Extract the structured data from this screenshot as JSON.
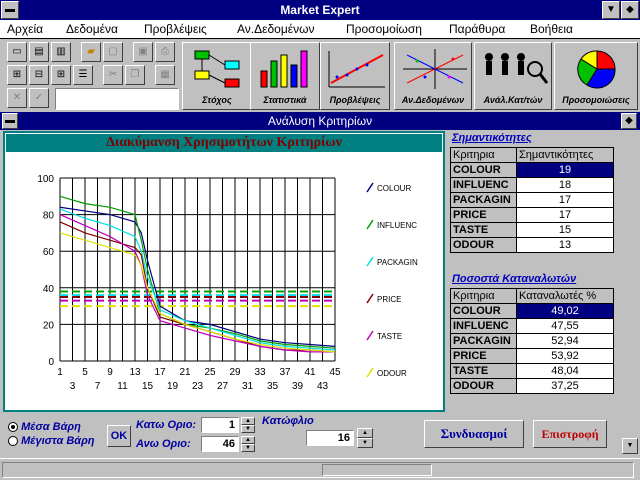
{
  "window": {
    "title": "Market Expert"
  },
  "menu": [
    {
      "label": "Αρχεία"
    },
    {
      "label": "Δεδομένα"
    },
    {
      "label": "Προβλέψεις"
    },
    {
      "label": "Αν.Δεδομένων"
    },
    {
      "label": "Προσομοίωση"
    },
    {
      "label": "Παράθυρα"
    },
    {
      "label": "Βοήθεια"
    }
  ],
  "modules": [
    {
      "label": "Στόχος",
      "icon": "target-flowchart-icon"
    },
    {
      "label": "Στατιστικά",
      "icon": "bar-chart-icon"
    },
    {
      "label": "Προβλέψεις",
      "icon": "trend-line-icon"
    },
    {
      "label": "Αν.Δεδομένων",
      "icon": "scatter-analysis-icon"
    },
    {
      "label": "Ανάλ.Κατ/τών",
      "icon": "people-analysis-icon"
    },
    {
      "label": "Προσομοιώσεις",
      "icon": "pie-chart-icon"
    }
  ],
  "panel": {
    "title": "Ανάλυση Κριτηρίων"
  },
  "chart_data": {
    "type": "line",
    "title": "Διακύμανση Χρησιμοτήτων Κριτηρίων",
    "ylim": [
      0,
      100
    ],
    "yticks": [
      0,
      20,
      40,
      60,
      80,
      100
    ],
    "xlim": [
      1,
      45
    ],
    "xticks_top": [
      "1",
      "5",
      "9",
      "13",
      "17",
      "21",
      "25",
      "29",
      "33",
      "37",
      "41",
      "45"
    ],
    "xticks_bottom": [
      "3",
      "7",
      "11",
      "15",
      "19",
      "23",
      "27",
      "31",
      "35",
      "39",
      "43"
    ],
    "grid": true,
    "legend_position": "right",
    "x": [
      1,
      5,
      9,
      13,
      14,
      15,
      17,
      21,
      25,
      29,
      33,
      37,
      41,
      45
    ],
    "series": [
      {
        "name": "COLOUR",
        "color": "#000080",
        "values": [
          84,
          82,
          80,
          76,
          70,
          55,
          30,
          22,
          20,
          16,
          12,
          10,
          9,
          8
        ]
      },
      {
        "name": "INFLUENC",
        "color": "#00a000",
        "values": [
          90,
          86,
          84,
          80,
          66,
          50,
          26,
          20,
          18,
          15,
          11,
          9,
          8,
          7
        ]
      },
      {
        "name": "PACKAGIN",
        "color": "#00e0e0",
        "values": [
          83,
          78,
          74,
          68,
          60,
          46,
          28,
          22,
          18,
          14,
          10,
          8,
          7,
          6
        ]
      },
      {
        "name": "PRICE",
        "color": "#800000",
        "values": [
          76,
          70,
          66,
          62,
          58,
          40,
          24,
          20,
          16,
          12,
          8,
          6,
          6,
          5
        ]
      },
      {
        "name": "TASTE",
        "color": "#c000c0",
        "values": [
          80,
          74,
          68,
          60,
          52,
          36,
          22,
          18,
          14,
          11,
          8,
          6,
          5,
          5
        ]
      },
      {
        "name": "ODOUR",
        "color": "#e0e000",
        "values": [
          70,
          66,
          62,
          58,
          52,
          40,
          26,
          20,
          16,
          12,
          9,
          7,
          6,
          5
        ]
      }
    ],
    "thresholds": [
      {
        "color": "#00a000",
        "value": 38
      },
      {
        "color": "#00e0e0",
        "value": 36
      },
      {
        "color": "#800000",
        "value": 35
      },
      {
        "color": "#c000c0",
        "value": 33
      },
      {
        "color": "#e0e000",
        "value": 30
      }
    ]
  },
  "importance": {
    "title": "Σημαντικότητες",
    "header": [
      "Κριτηρια",
      "Σημαντικότητες"
    ],
    "rows": [
      {
        "name": "COLOUR",
        "value": "19"
      },
      {
        "name": "INFLUENC",
        "value": "18"
      },
      {
        "name": "PACKAGIN",
        "value": "17"
      },
      {
        "name": "PRICE",
        "value": "17"
      },
      {
        "name": "TASTE",
        "value": "15"
      },
      {
        "name": "ODOUR",
        "value": "13"
      }
    ]
  },
  "consumers": {
    "title": "Ποσοστά Καταναλωτών",
    "header": [
      "Κριτηρια",
      "Καταναλωτές %"
    ],
    "rows": [
      {
        "name": "COLOUR",
        "value": "49,02"
      },
      {
        "name": "INFLUENC",
        "value": "47,55"
      },
      {
        "name": "PACKAGIN",
        "value": "52,94"
      },
      {
        "name": "PRICE",
        "value": "53,92"
      },
      {
        "name": "TASTE",
        "value": "48,04"
      },
      {
        "name": "ODOUR",
        "value": "37,25"
      }
    ]
  },
  "controls": {
    "radio_mean": "Μέσα Βάρη",
    "radio_max": "Μέγιστα Βάρη",
    "ok": "OK",
    "lower_label": "Κατω Οριο:",
    "lower_value": "1",
    "upper_label": "Ανω Οριο:",
    "upper_value": "46",
    "threshold_label": "Κατώφλιο",
    "threshold_value": "16",
    "combinations": "Συνδυασμοί",
    "return": "Επιστροφή"
  }
}
